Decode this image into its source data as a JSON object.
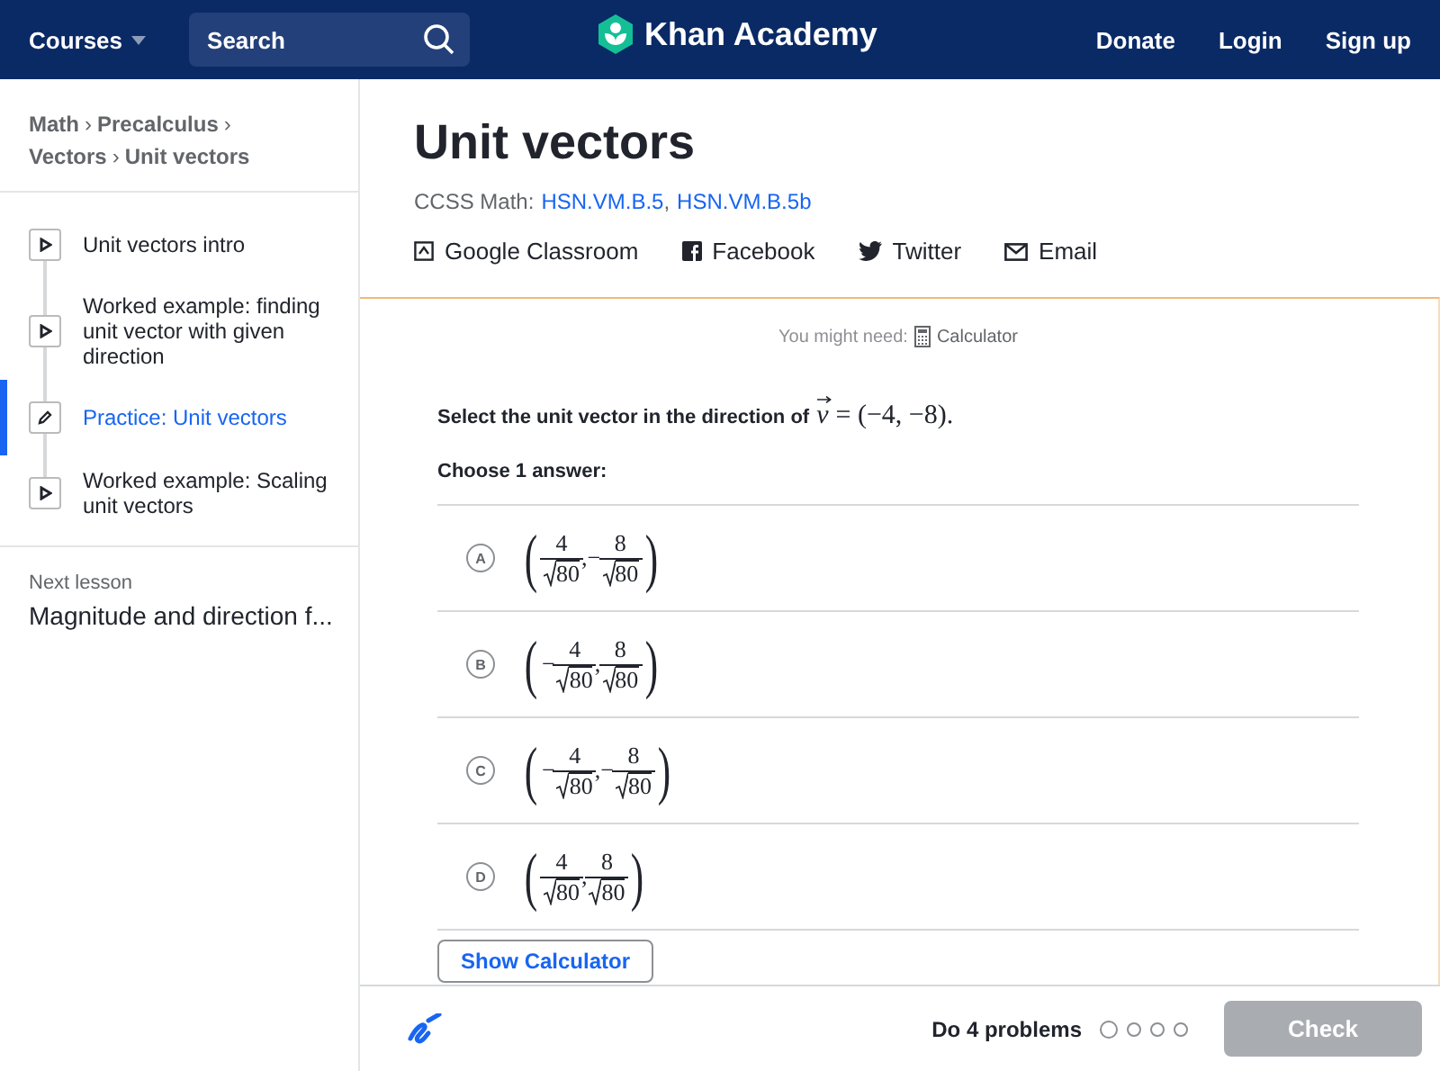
{
  "header": {
    "courses": "Courses",
    "search": {
      "placeholder": "Search"
    },
    "logo": "Khan Academy",
    "links": [
      "Donate",
      "Login",
      "Sign up"
    ]
  },
  "breadcrumbs": [
    {
      "label": "Math"
    },
    {
      "label": "Precalculus"
    },
    {
      "label": "Vectors"
    },
    {
      "label": "Unit vectors"
    }
  ],
  "breadcrumb_separator": "›",
  "lessons": [
    {
      "kind": "video",
      "label": "Unit vectors intro",
      "selected": false
    },
    {
      "kind": "video",
      "label": "Worked example: finding unit vector with given direction",
      "selected": false
    },
    {
      "kind": "practice",
      "label": "Practice: Unit vectors",
      "selected": true
    },
    {
      "kind": "video",
      "label": "Worked example: Scaling unit vectors",
      "selected": false
    }
  ],
  "next_lesson": {
    "label": "Next lesson",
    "title": "Magnitude and direction f..."
  },
  "title": "Unit vectors",
  "standards": {
    "label": "CCSS Math:",
    "links": [
      "HSN.VM.B.5",
      "HSN.VM.B.5b"
    ],
    "separator": ","
  },
  "share": [
    {
      "kind": "classroom",
      "label": "Google Classroom"
    },
    {
      "kind": "facebook",
      "label": "Facebook"
    },
    {
      "kind": "twitter",
      "label": "Twitter"
    },
    {
      "kind": "email",
      "label": "Email"
    }
  ],
  "tools": {
    "label": "You might need:",
    "tool": "Calculator"
  },
  "question": {
    "text": "Select the unit vector in the direction of",
    "variable": "v",
    "math": "= (−4, −8)."
  },
  "choose_label": "Choose 1 answer:",
  "options": [
    {
      "letter": "A",
      "selected": false,
      "open": "(",
      "close": ")",
      "comma": ",",
      "terms": [
        {
          "numerator": "4",
          "radicand": "80"
        },
        {
          "sign": "−",
          "numerator": "8",
          "radicand": "80"
        }
      ]
    },
    {
      "letter": "B",
      "selected": false,
      "open": "(",
      "close": ")",
      "comma": ",",
      "terms": [
        {
          "sign": "−",
          "numerator": "4",
          "radicand": "80"
        },
        {
          "numerator": "8",
          "radicand": "80"
        }
      ]
    },
    {
      "letter": "C",
      "selected": false,
      "open": "(",
      "close": ")",
      "comma": ",",
      "terms": [
        {
          "sign": "−",
          "numerator": "4",
          "radicand": "80"
        },
        {
          "sign": "−",
          "numerator": "8",
          "radicand": "80"
        }
      ]
    },
    {
      "letter": "D",
      "selected": false,
      "open": "(",
      "close": ")",
      "comma": ",",
      "terms": [
        {
          "numerator": "4",
          "radicand": "80"
        },
        {
          "numerator": "8",
          "radicand": "80"
        }
      ]
    }
  ],
  "calculator_button": "Show Calculator",
  "footer": {
    "goal": "Do 4 problems",
    "dots": [
      {
        "selected": true
      },
      {
        "selected": false
      },
      {
        "selected": false
      },
      {
        "selected": false
      }
    ],
    "check": {
      "label": "Check",
      "disabled": true
    }
  }
}
